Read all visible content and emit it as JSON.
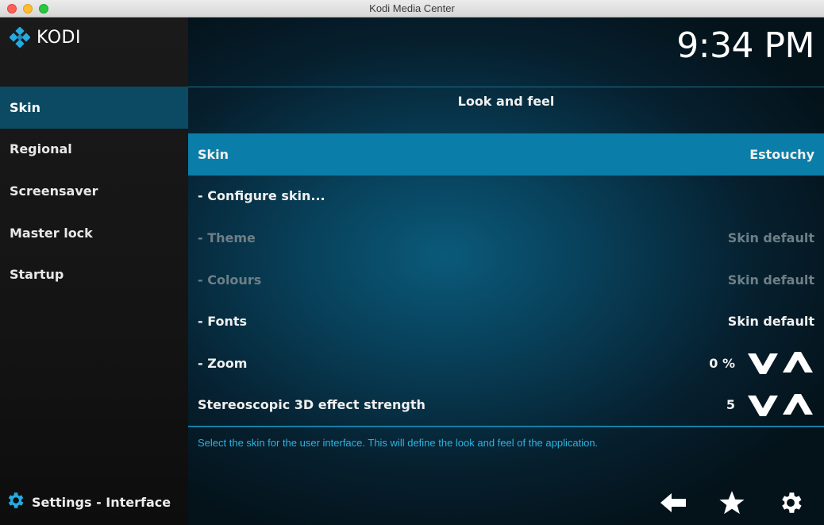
{
  "window": {
    "title": "Kodi Media Center"
  },
  "brand": {
    "logo_text": "KODI",
    "accent": "#0a7ea8"
  },
  "clock": "9:34 PM",
  "sidebar": {
    "items": [
      {
        "label": "Skin",
        "active": true
      },
      {
        "label": "Regional"
      },
      {
        "label": "Screensaver"
      },
      {
        "label": "Master lock"
      },
      {
        "label": "Startup"
      }
    ],
    "footer_label": "Settings - Interface",
    "footer_icon": "gear-icon"
  },
  "section": {
    "title": "Look and feel"
  },
  "settings": [
    {
      "label": "Skin",
      "value": "Estouchy"
    },
    {
      "label": "- Configure skin...",
      "value": ""
    },
    {
      "label": "- Theme",
      "value": "Skin default"
    },
    {
      "label": "- Colours",
      "value": "Skin default"
    },
    {
      "label": "- Fonts",
      "value": "Skin default"
    },
    {
      "label": "- Zoom",
      "value": "0 %"
    },
    {
      "label": "Stereoscopic 3D effect strength",
      "value": "5"
    }
  ],
  "description": "Select the skin for the user interface. This will define the look and feel of the application.",
  "footer_buttons": [
    "back-arrow-icon",
    "star-icon",
    "gear-icon"
  ]
}
